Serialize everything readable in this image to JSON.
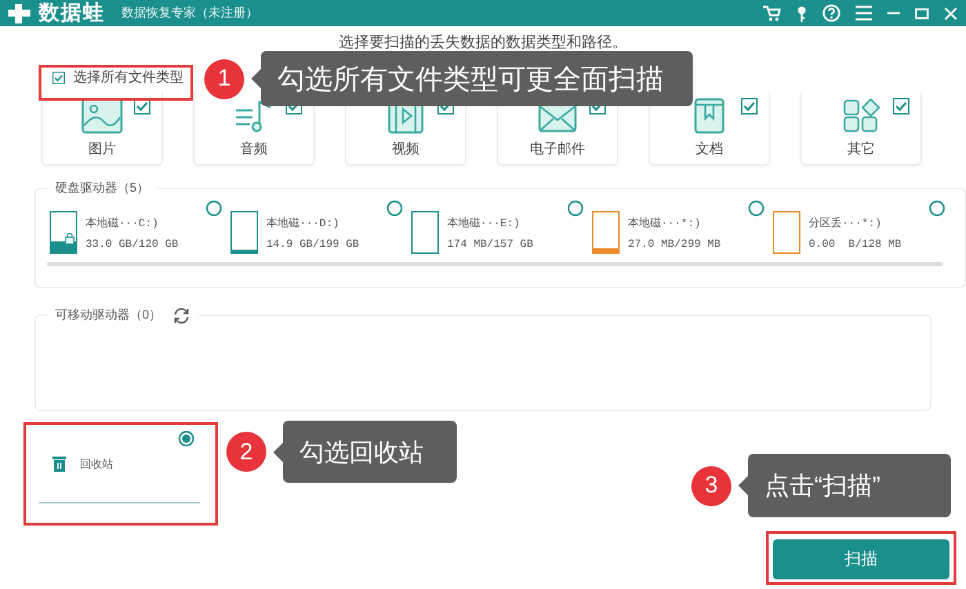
{
  "window": {
    "logo": "数据蛙",
    "subtitle": "数据恢复专家（未注册）"
  },
  "instruction": "选择要扫描的丢失数据的数据类型和路径。",
  "select_all": {
    "label": "选择所有文件类型",
    "checked": true
  },
  "file_types": [
    {
      "kind": "image",
      "label": "图片",
      "checked": true
    },
    {
      "kind": "audio",
      "label": "音频",
      "checked": true
    },
    {
      "kind": "video",
      "label": "视频",
      "checked": true
    },
    {
      "kind": "email",
      "label": "电子邮件",
      "checked": true
    },
    {
      "kind": "document",
      "label": "文档",
      "checked": true
    },
    {
      "kind": "other",
      "label": "其它",
      "checked": true
    }
  ],
  "hard_drives": {
    "title": "硬盘驱动器（5）",
    "drives": [
      {
        "name": "本地磁···C:)",
        "size": "33.0 GB/120 GB",
        "level": 0.28,
        "color": "#1a8f8c",
        "system": true,
        "selected": false
      },
      {
        "name": "本地磁···D:)",
        "size": "14.9 GB/199 GB",
        "level": 0.08,
        "color": "#1a8f8c",
        "system": false,
        "selected": false
      },
      {
        "name": "本地磁···E:)",
        "size": "174 MB/157 GB",
        "level": 0,
        "color": "#1a8f8c",
        "system": false,
        "selected": false
      },
      {
        "name": "本地磁···*:)",
        "size": "27.0 MB/299 MB",
        "level": 0.09,
        "color": "#e8892a",
        "system": false,
        "selected": false
      },
      {
        "name": "分区丢···*:)",
        "size": "0.00  B/128 MB",
        "level": 0,
        "color": "#e8892a",
        "system": false,
        "selected": false
      }
    ]
  },
  "removable": {
    "title": "可移动驱动器（0）"
  },
  "recycle_bin": {
    "label": "回收站",
    "selected": true
  },
  "scan_button": "扫描",
  "callouts": [
    {
      "number": "1",
      "text": "勾选所有文件类型可更全面扫描"
    },
    {
      "number": "2",
      "text": "勾选回收站"
    },
    {
      "number": "3",
      "text": "点击“扫描”"
    }
  ]
}
